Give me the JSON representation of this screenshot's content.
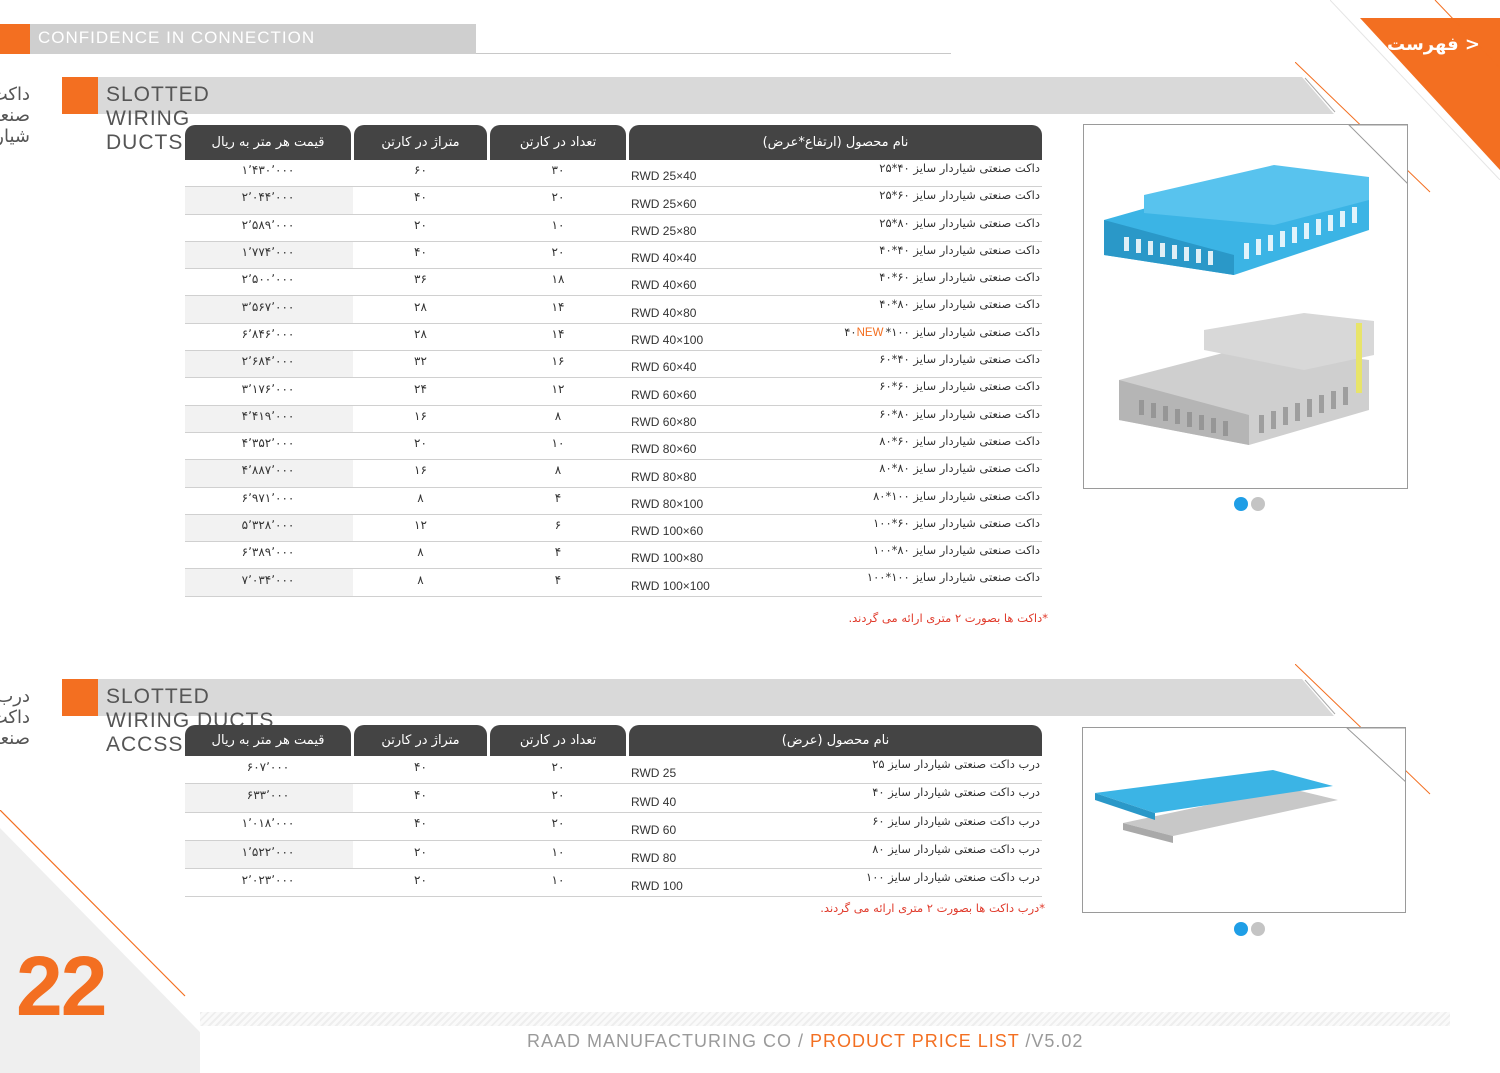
{
  "header": {
    "tagline": "CONFIDENCE IN CONNECTION",
    "menu_label": "< فهرست"
  },
  "colors": {
    "accent": "#f36f21",
    "table_header": "#444444",
    "note": "#e03a2b",
    "duct_blue": "#3bb4e5",
    "duct_gray": "#c9c9c9"
  },
  "section1": {
    "title_en": "SLOTTED WIRING DUCTS",
    "title_fa": "داکت صنعتی شیاردار",
    "columns": {
      "price": "قیمت هر متر به ریال",
      "meter": "متراژ در کارتن",
      "count": "تعداد در کارتن",
      "name": "نام محصول (ارتفاع*عرض)"
    },
    "rows": [
      {
        "price": "۱٬۴۳۰٬۰۰۰",
        "meter": "۶۰",
        "count": "۳۰",
        "code": "RWD  25×40",
        "name": "داکت صنعتی شیاردار سایز ۴۰*۲۵",
        "new": ""
      },
      {
        "price": "۲٬۰۴۴٬۰۰۰",
        "meter": "۴۰",
        "count": "۲۰",
        "code": "RWD  25×60",
        "name": "داکت صنعتی شیاردار سایز ۶۰*۲۵",
        "new": ""
      },
      {
        "price": "۲٬۵۸۹٬۰۰۰",
        "meter": "۲۰",
        "count": "۱۰",
        "code": "RWD  25×80",
        "name": "داکت صنعتی شیاردار سایز ۸۰*۲۵",
        "new": ""
      },
      {
        "price": "۱٬۷۷۴٬۰۰۰",
        "meter": "۴۰",
        "count": "۲۰",
        "code": "RWD  40×40",
        "name": "داکت صنعتی شیاردار سایز ۴۰*۴۰",
        "new": ""
      },
      {
        "price": "۲٬۵۰۰٬۰۰۰",
        "meter": "۳۶",
        "count": "۱۸",
        "code": "RWD  40×60",
        "name": "داکت صنعتی شیاردار سایز ۶۰*۴۰",
        "new": ""
      },
      {
        "price": "۳٬۵۶۷٬۰۰۰",
        "meter": "۲۸",
        "count": "۱۴",
        "code": "RWD  40×80",
        "name": "داکت صنعتی شیاردار سایز ۸۰*۴۰",
        "new": ""
      },
      {
        "price": "۶٬۸۴۶٬۰۰۰",
        "meter": "۲۸",
        "count": "۱۴",
        "code": "RWD  40×100",
        "name": "داکت صنعتی شیاردار سایز ۱۰۰*۴۰",
        "new": "NEW"
      },
      {
        "price": "۲٬۶۸۴٬۰۰۰",
        "meter": "۳۲",
        "count": "۱۶",
        "code": "RWD  60×40",
        "name": "داکت صنعتی شیاردار سایز ۴۰*۶۰",
        "new": ""
      },
      {
        "price": "۳٬۱۷۶٬۰۰۰",
        "meter": "۲۴",
        "count": "۱۲",
        "code": "RWD  60×60",
        "name": "داکت صنعتی شیاردار سایز ۶۰*۶۰",
        "new": ""
      },
      {
        "price": "۴٬۴۱۹٬۰۰۰",
        "meter": "۱۶",
        "count": "۸",
        "code": "RWD  60×80",
        "name": "داکت صنعتی شیاردار سایز ۸۰*۶۰",
        "new": ""
      },
      {
        "price": "۴٬۳۵۲٬۰۰۰",
        "meter": "۲۰",
        "count": "۱۰",
        "code": "RWD  80×60",
        "name": "داکت صنعتی شیاردار سایز ۶۰*۸۰",
        "new": ""
      },
      {
        "price": "۴٬۸۸۷٬۰۰۰",
        "meter": "۱۶",
        "count": "۸",
        "code": "RWD  80×80",
        "name": "داکت صنعتی شیاردار سایز ۸۰*۸۰",
        "new": ""
      },
      {
        "price": "۶٬۹۷۱٬۰۰۰",
        "meter": "۸",
        "count": "۴",
        "code": "RWD  80×100",
        "name": "داکت صنعتی شیاردار سایز ۱۰۰*۸۰",
        "new": ""
      },
      {
        "price": "۵٬۳۲۸٬۰۰۰",
        "meter": "۱۲",
        "count": "۶",
        "code": "RWD  100×60",
        "name": "داکت صنعتی شیاردار سایز ۶۰*۱۰۰",
        "new": ""
      },
      {
        "price": "۶٬۳۸۹٬۰۰۰",
        "meter": "۸",
        "count": "۴",
        "code": "RWD  100×80",
        "name": "داکت صنعتی شیاردار سایز ۸۰*۱۰۰",
        "new": ""
      },
      {
        "price": "۷٬۰۳۴٬۰۰۰",
        "meter": "۸",
        "count": "۴",
        "code": "RWD  100×100",
        "name": "داکت صنعتی شیاردار سایز ۱۰۰*۱۰۰",
        "new": ""
      }
    ],
    "note": "*داکت ها بصورت ۲ متری ارائه می گردند."
  },
  "section2": {
    "title_en": "SLOTTED WIRING DUCTS ACCSSESORIES",
    "title_fa": "درب داکت صنعتی",
    "columns": {
      "price": "قیمت هر متر به ریال",
      "meter": "متراژ در کارتن",
      "count": "تعداد در کارتن",
      "name": "نام محصول (عرض)"
    },
    "rows": [
      {
        "price": "۶۰۷٬۰۰۰",
        "meter": "۴۰",
        "count": "۲۰",
        "code": "RWD  25",
        "name": "درب داکت صنعتی شیاردار سایز ۲۵",
        "new": ""
      },
      {
        "price": "۶۳۳٬۰۰۰",
        "meter": "۴۰",
        "count": "۲۰",
        "code": "RWD  40",
        "name": "درب داکت صنعتی شیاردار سایز ۴۰",
        "new": ""
      },
      {
        "price": "۱٬۰۱۸٬۰۰۰",
        "meter": "۴۰",
        "count": "۲۰",
        "code": "RWD  60",
        "name": "درب داکت صنعتی شیاردار سایز ۶۰",
        "new": ""
      },
      {
        "price": "۱٬۵۲۲٬۰۰۰",
        "meter": "۲۰",
        "count": "۱۰",
        "code": "RWD  80",
        "name": "درب داکت صنعتی شیاردار سایز ۸۰",
        "new": ""
      },
      {
        "price": "۲٬۰۲۳٬۰۰۰",
        "meter": "۲۰",
        "count": "۱۰",
        "code": "RWD  100",
        "name": "درب داکت صنعتی شیاردار سایز ۱۰۰",
        "new": ""
      }
    ],
    "note": "*درب داکت ها بصورت ۲ متری ارائه می گردند."
  },
  "footer": {
    "page_number": "22",
    "company": "RAAD MANUFACTURING CO / ",
    "doc": "PRODUCT PRICE LIST",
    "version": " /V5.02"
  }
}
